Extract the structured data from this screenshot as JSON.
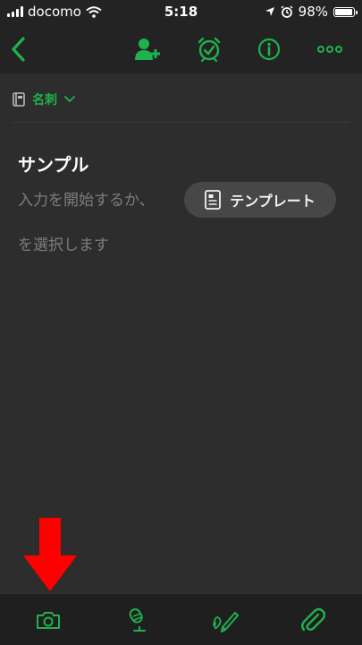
{
  "status_bar": {
    "carrier": "docomo",
    "time": "5:18",
    "battery": "98%",
    "battery_level": 0.98
  },
  "nav": {
    "icons": [
      "back-chevron-icon",
      "share-person-add-icon",
      "reminder-alarm-icon",
      "info-icon",
      "more-dots-icon"
    ]
  },
  "notebook": {
    "name": "名刺"
  },
  "note": {
    "title": "サンプル",
    "prompt_part1": "入力を開始するか、",
    "prompt_part2": "を選択します",
    "template_button_label": "テンプレート"
  },
  "toolbar": {
    "icons": [
      "camera-icon",
      "microphone-icon",
      "handwriting-pen-icon",
      "attachment-paperclip-icon"
    ]
  },
  "colors": {
    "accent": "#1fb14d",
    "background": "#2d2d2d",
    "bar": "#232323",
    "annotation_arrow": "#ff0000"
  }
}
